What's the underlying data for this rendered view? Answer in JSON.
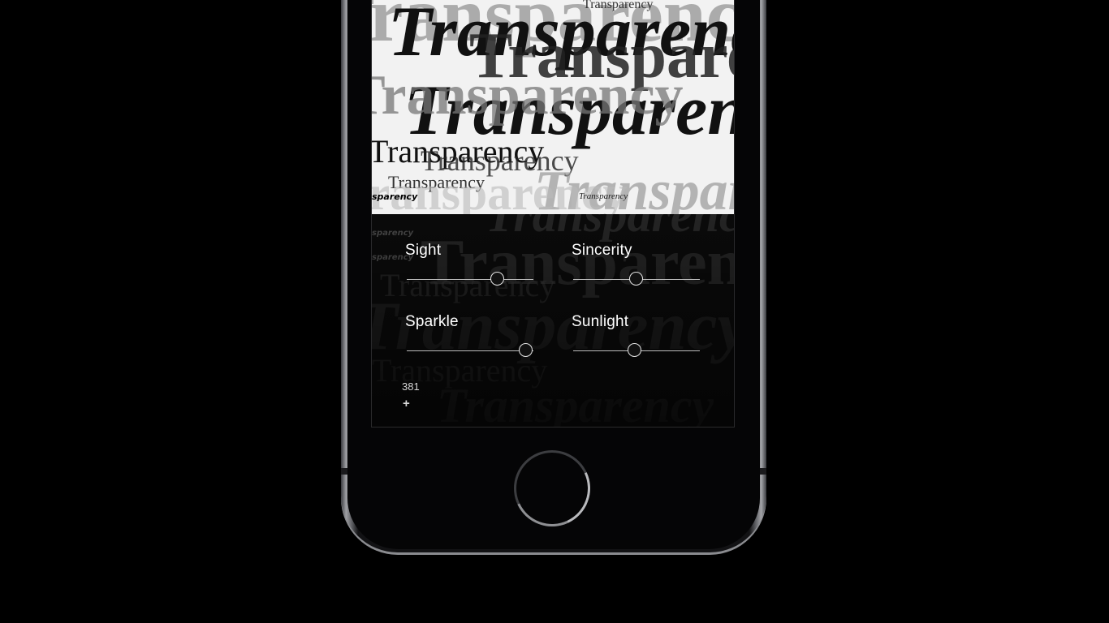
{
  "poster": {
    "word": "Transparency",
    "word_short": "sparency",
    "word_italic_small": "Transparency"
  },
  "controls": [
    {
      "label": "Sight",
      "value": 0.72
    },
    {
      "label": "Sincerity",
      "value": 0.5
    },
    {
      "label": "Sparkle",
      "value": 0.94
    },
    {
      "label": "Sunlight",
      "value": 0.49
    }
  ],
  "footer": {
    "count": "381",
    "add": "+"
  },
  "colors": {
    "background": "#000000",
    "screen_text": "#ffffff",
    "track": "#bdbdbd"
  },
  "icons": {
    "home": "home-button-icon",
    "add": "plus-icon"
  }
}
